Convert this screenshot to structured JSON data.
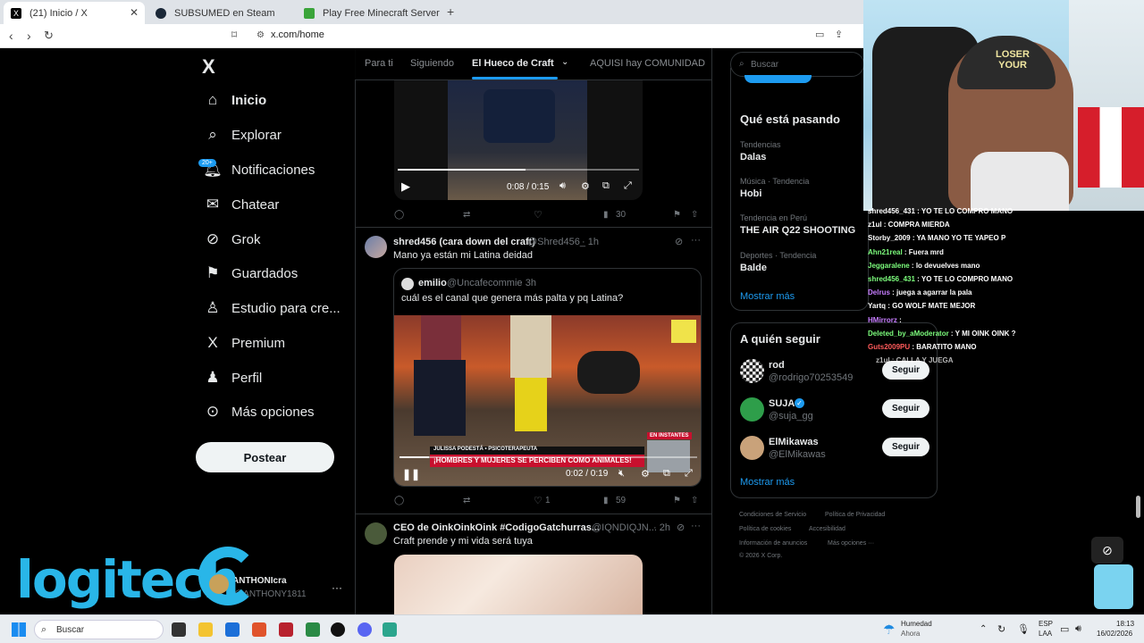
{
  "browser": {
    "tabs": [
      {
        "title": "(21) Inicio / X",
        "active": true
      },
      {
        "title": "SUBSUMED en Steam",
        "active": false
      },
      {
        "title": "Play Free Minecraft Server Hosting T",
        "active": false
      }
    ],
    "new_tab": "+",
    "url": "x.com/home"
  },
  "sidebar": {
    "logo": "X",
    "items": [
      {
        "label": "Inicio",
        "icon": "home-icon"
      },
      {
        "label": "Explorar",
        "icon": "search-icon"
      },
      {
        "label": "Notificaciones",
        "icon": "bell-icon",
        "badge": "20+"
      },
      {
        "label": "Chatear",
        "icon": "mail-icon"
      },
      {
        "label": "Grok",
        "icon": "grok-icon"
      },
      {
        "label": "Guardados",
        "icon": "bookmark-icon"
      },
      {
        "label": "Estudio para cre...",
        "icon": "studio-icon"
      },
      {
        "label": "Premium",
        "icon": "premium-icon"
      },
      {
        "label": "Perfil",
        "icon": "person-icon"
      },
      {
        "label": "Más opciones",
        "icon": "more-circle-icon"
      }
    ],
    "post_button": "Postear",
    "account": {
      "name": "ANTHONIcra",
      "handle": "@ANTHONY1811",
      "more": "···"
    }
  },
  "feed": {
    "tabs": [
      "Para ti",
      "Siguiendo",
      "El Hueco de Craft",
      "AQUISI hay COMUNIDAD"
    ],
    "selected_tab": "El Hueco de Craft",
    "video1": {
      "time": "0:08 / 0:15",
      "progress": 0.53
    },
    "post1_actions": {
      "views": "30"
    },
    "post2": {
      "name": "shred456 (cara down del craft)",
      "handle": "@Shred456_",
      "time": "· 1h",
      "text": "Mano ya están mi Latina deidad",
      "quote": {
        "name": "emilio",
        "handle": "@Uncafecommie",
        "time": "· 3h",
        "text": "cuál es el canal que genera más palta y pq Latina?"
      },
      "video": {
        "time": "0:02 / 0:19",
        "progress": 0.1,
        "banner_top": "JULISSA PODESTÁ • PSICOTERAPEUTA",
        "banner": "¡HOMBRES Y MUJERES SE PERCIBEN COMO ANIMALES!",
        "badge": "EN INSTANTES"
      },
      "likes": "1",
      "views": "59"
    },
    "post3": {
      "name": "CEO de OinkOinkOink #CodigoGatchurras...",
      "handle": "@IQNDIQJN...",
      "time": "· 2h",
      "text": "Craft prende y mi vida será tuya"
    }
  },
  "right": {
    "search_placeholder": "Buscar",
    "trends_title": "Qué está pasando",
    "trends": [
      {
        "meta": "Tendencias",
        "name": "Dalas"
      },
      {
        "meta": "Música · Tendencia",
        "name": "Hobi"
      },
      {
        "meta": "Tendencia en Perú",
        "name": "THE AIR Q22 SHOOTING"
      },
      {
        "meta": "Deportes · Tendencia",
        "name": "Balde"
      }
    ],
    "show_more": "Mostrar más",
    "follow_title": "A quién seguir",
    "follow": [
      {
        "name": "rod",
        "handle": "@rodrigo70253549",
        "button": "Seguir"
      },
      {
        "name": "SUJA",
        "handle": "@suja_gg",
        "button": "Seguir"
      },
      {
        "name": "ElMikawas",
        "handle": "@ElMikawas",
        "button": "Seguir"
      }
    ],
    "footer": [
      "Condiciones de Servicio",
      "Política de Privacidad",
      "Política de cookies",
      "Accesibilidad",
      "Información de anuncios",
      "Más opciones ···",
      "© 2026 X Corp."
    ]
  },
  "stream": {
    "chat": [
      {
        "user": "shred456_431",
        "text": "YO TE LO COMPRO MANO",
        "color": "#ffffff"
      },
      {
        "user": "z1ul",
        "text": "COMPRA MIERDA",
        "color": "#ffffff"
      },
      {
        "user": "Storby_2009",
        "text": "YA MANO YO TE YAPEO P",
        "color": "#ffffff"
      },
      {
        "user": "Ahn21real",
        "text": "Fuera mrd",
        "color": "#7cfc7c"
      },
      {
        "user": "Jeggaralene",
        "text": "lo devuelves mano",
        "color": "#7cfc7c"
      },
      {
        "user": "shred456_431",
        "text": "YO TE LO COMPRO MANO",
        "color": "#7cfc7c"
      },
      {
        "user": "Delrus",
        "text": "juega a agarrar la pala",
        "color": "#c77dff"
      },
      {
        "user": "Yartq",
        "text": "GO WOLF MATE MEJOR",
        "color": "#ffffff"
      },
      {
        "user": "HMirrorz",
        "text": "",
        "color": "#c77dff"
      },
      {
        "user": "Deleted_by_aModerator",
        "text": "Y MI OINK OINK ?",
        "color": "#7cfc7c"
      },
      {
        "user": "Guts2009PU",
        "text": "BARATITO MANO",
        "color": "#ff5a5a"
      },
      {
        "user": "z1ul",
        "text": "CALLA Y JUEGA",
        "color": "#ffffff"
      }
    ],
    "sponsor": "logitech",
    "cap_text": "LOSER YOUR"
  },
  "taskbar": {
    "search": "Buscar",
    "weather": "Humedad",
    "weather_sub": "Ahora",
    "lang": "ESP",
    "lang_sub": "LAA",
    "time": "18:13",
    "date": "16/02/2026"
  },
  "colors": {
    "accent": "#1d9bf0",
    "bg": "#000000",
    "border": "#2f3336"
  }
}
